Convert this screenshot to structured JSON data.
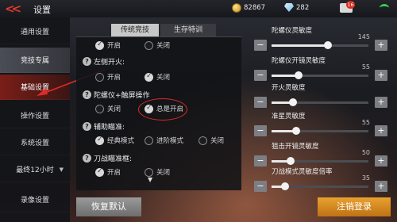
{
  "header": {
    "title": "设置",
    "coins": "82867",
    "gems": "282",
    "mail_badge": "16"
  },
  "sidebar": {
    "items": [
      {
        "label": "通用设置"
      },
      {
        "label": "竞技专属"
      },
      {
        "label": "基础设置"
      },
      {
        "label": "操作设置"
      },
      {
        "label": "系统设置"
      },
      {
        "label": "最终12小时"
      },
      {
        "label": "录像设置"
      }
    ]
  },
  "tabs": {
    "active": "传统竞技",
    "other": "生存特训"
  },
  "settings": {
    "row0": {
      "opt_on": "开启",
      "opt_off": "关闭"
    },
    "fire_left": {
      "title": "左侧开火:",
      "opt_on": "开启",
      "opt_off": "关闭"
    },
    "gyro": {
      "title": "陀螺仪+触屏操作",
      "opt_off": "关闭",
      "opt_always": "总是开启"
    },
    "aim_assist": {
      "title": "辅助瞄准:",
      "opt_classic": "经典模式",
      "opt_advanced": "进阶模式",
      "opt_off": "关闭"
    },
    "knife_aim": {
      "title": "刀战瞄准框:",
      "opt_on": "开启",
      "opt_off": "关闭"
    }
  },
  "sliders": [
    {
      "label": "陀螺仪灵敏度",
      "value": "145",
      "level": 0.58
    },
    {
      "label": "陀螺仪开镜灵敏度",
      "value": "55",
      "level": 0.28
    },
    {
      "label": "开火灵敏度",
      "value": "",
      "level": 0.22
    },
    {
      "label": "准星灵敏度",
      "value": "55",
      "level": 0.25
    },
    {
      "label": "狙击开镜灵敏度",
      "value": "50",
      "level": 0.2
    },
    {
      "label": "刀战模式灵敏度倍率",
      "value": "35",
      "level": 0.14
    }
  ],
  "buttons": {
    "reset": "恢复默认",
    "logout": "注销登录"
  },
  "colors": {
    "accent_red": "#e02a25",
    "logout_orange": "#e8a230",
    "active_tab": "#c8c8c8"
  }
}
